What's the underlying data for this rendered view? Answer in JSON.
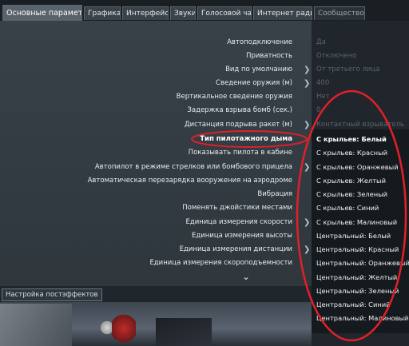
{
  "tabs": [
    {
      "label": "Основные параметры",
      "active": true
    },
    {
      "label": "Графика"
    },
    {
      "label": "Интерфейс"
    },
    {
      "label": "Звуки"
    },
    {
      "label": "Голосовой чат"
    },
    {
      "label": "Интернет радио"
    },
    {
      "label": "Сообщество"
    }
  ],
  "settings": [
    {
      "label": "Автоподключение",
      "value": "Да"
    },
    {
      "label": "Приватность",
      "value": "Отключено"
    },
    {
      "label": "Вид по умолчанию",
      "value": "От третьего лица"
    },
    {
      "label": "Сведение оружия (м)",
      "value": "400"
    },
    {
      "label": "Вертикальное сведение оружия",
      "value": "Нет"
    },
    {
      "label": "Задержка взрыва бомб (сек.)",
      "value": "0"
    },
    {
      "label": "Дистанция подрыва ракет (м)",
      "value": "Контактный взрыватель"
    },
    {
      "label": "Тип пилотажного дыма"
    },
    {
      "label": "Показывать пилота в кабине"
    },
    {
      "label": "Автопилот в режиме стрелков или бомбового прицела"
    },
    {
      "label": "Автоматическая перезарядка вооружения на аэродроме"
    },
    {
      "label": "Вибрация"
    },
    {
      "label": "Поменять джойстики местами"
    },
    {
      "label": "Единица измерения скорости"
    },
    {
      "label": "Единица измерения высоты"
    },
    {
      "label": "Единица измерения дистанции"
    },
    {
      "label": "Единица измерения скороподъемности"
    }
  ],
  "smoke_options": [
    "С крыльев: Белый",
    "С крыльев: Красный",
    "С крыльев: Оранжевый",
    "С крыльев: Желтый",
    "С крыльев: Зеленый",
    "С крыльев: Синий",
    "С крыльев: Малиновый",
    "Центральный: Белый",
    "Центральный: Красный",
    "Центральный: Оранжевый",
    "Центральный: Желтый",
    "Центральный: Зеленый",
    "Центральный: Синий",
    "Центральный: Малиновый"
  ],
  "postfx_button": "Настройка постэффектов",
  "colors": {
    "annotation": "#e0202a",
    "active_tab": "#59636b"
  }
}
